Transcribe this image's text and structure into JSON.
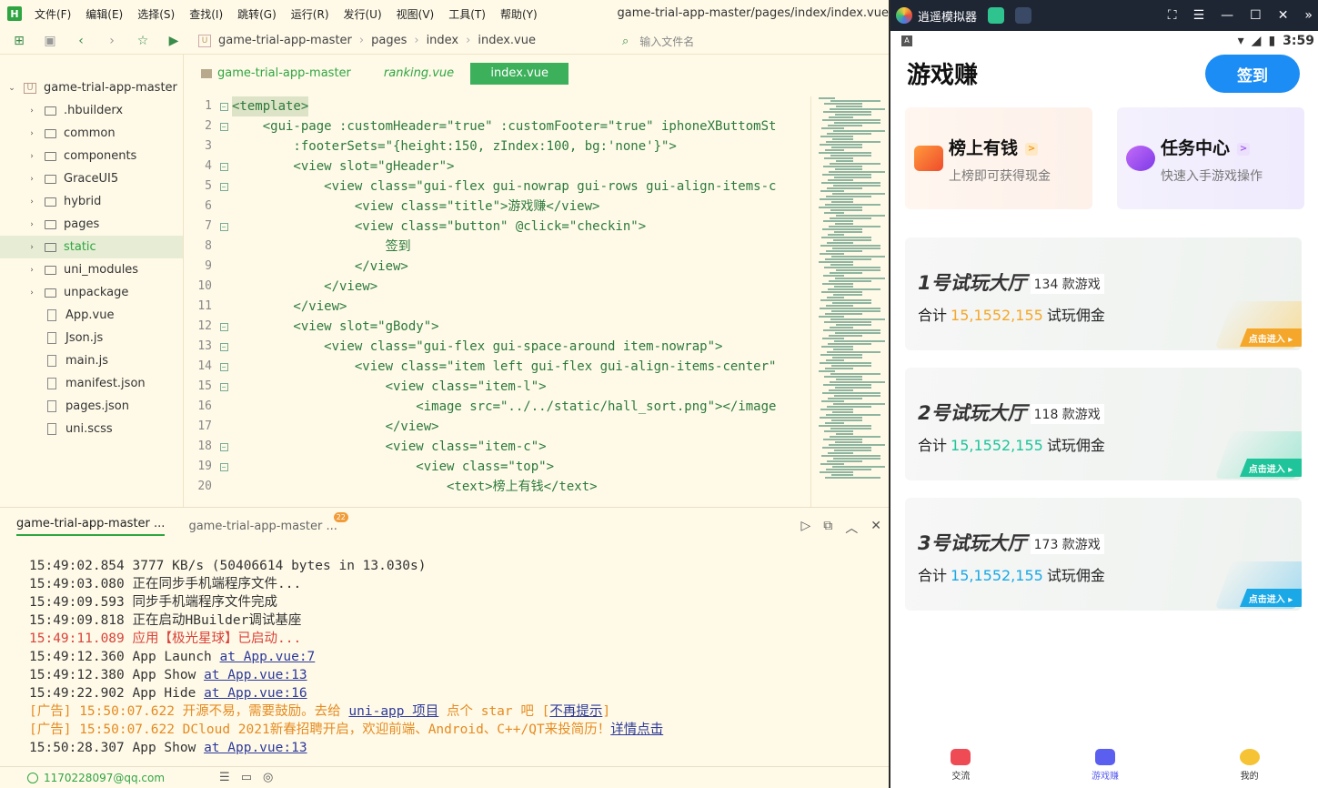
{
  "ide": {
    "logo": "H",
    "menu": [
      "文件(F)",
      "编辑(E)",
      "选择(S)",
      "查找(I)",
      "跳转(G)",
      "运行(R)",
      "发行(U)",
      "视图(V)",
      "工具(T)",
      "帮助(Y)"
    ],
    "window_title": "game-trial-app-master/pages/index/index.vue",
    "breadcrumb": [
      "game-trial-app-master",
      "pages",
      "index",
      "index.vue"
    ],
    "search_placeholder": "输入文件名",
    "tree": [
      {
        "label": "game-trial-app-master",
        "type": "project",
        "expanded": true
      },
      {
        "label": ".hbuilderx",
        "type": "folder"
      },
      {
        "label": "common",
        "type": "folder"
      },
      {
        "label": "components",
        "type": "folder"
      },
      {
        "label": "GraceUI5",
        "type": "folder"
      },
      {
        "label": "hybrid",
        "type": "folder"
      },
      {
        "label": "pages",
        "type": "folder"
      },
      {
        "label": "static",
        "type": "folder",
        "selected": true
      },
      {
        "label": "uni_modules",
        "type": "folder"
      },
      {
        "label": "unpackage",
        "type": "folder"
      },
      {
        "label": "App.vue",
        "type": "file"
      },
      {
        "label": "Json.js",
        "type": "file"
      },
      {
        "label": "main.js",
        "type": "file"
      },
      {
        "label": "manifest.json",
        "type": "file"
      },
      {
        "label": "pages.json",
        "type": "file"
      },
      {
        "label": "uni.scss",
        "type": "file"
      }
    ],
    "editor_tabs": [
      "game-trial-app-master",
      "ranking.vue",
      "index.vue"
    ],
    "code_lines": [
      "<template>",
      "    <gui-page :customHeader=\"true\" :customFooter=\"true\" iphoneXButtomSt",
      "        :footerSets=\"{height:150, zIndex:100, bg:'none'}\">",
      "        <view slot=\"gHeader\">",
      "            <view class=\"gui-flex gui-nowrap gui-rows gui-align-items-c",
      "                <view class=\"title\">游戏赚</view>",
      "                <view class=\"button\" @click=\"checkin\">",
      "                    签到",
      "                </view>",
      "            </view>",
      "        </view>",
      "        <view slot=\"gBody\">",
      "            <view class=\"gui-flex gui-space-around item-nowrap\">",
      "                <view class=\"item left gui-flex gui-align-items-center\"",
      "                    <view class=\"item-l\">",
      "                        <image src=\"../../static/hall_sort.png\"></image",
      "                    </view>",
      "                    <view class=\"item-c\">",
      "                        <view class=\"top\">",
      "                            <text>榜上有钱</text>"
    ],
    "console_tabs": [
      "game-trial-app-master ...",
      "game-trial-app-master ..."
    ],
    "console_badge": "22",
    "console_lines": [
      {
        "t": "15:49:02.854 3777 KB/s (50406614 bytes in 13.030s)",
        "c": ""
      },
      {
        "t": "15:49:03.080 正在同步手机端程序文件...",
        "c": ""
      },
      {
        "t": "15:49:09.593 同步手机端程序文件完成",
        "c": ""
      },
      {
        "t": "15:49:09.818 正在启动HBuilder调试基座",
        "c": ""
      },
      {
        "t": "15:49:11.089 应用【极光星球】已启动...",
        "c": "red"
      },
      {
        "t": "15:49:12.360 App Launch ",
        "l": "at App.vue:7",
        "c": ""
      },
      {
        "t": "15:49:12.380 App Show ",
        "l": "at App.vue:13",
        "c": ""
      },
      {
        "t": "15:49:22.902 App Hide ",
        "l": "at App.vue:16",
        "c": ""
      },
      {
        "t": "[广告] 15:50:07.622 开源不易，需要鼓励。去给 ",
        "l": "uni-app 项目",
        "t2": " 点个 star 吧 [",
        "l2": "不再提示",
        "t3": "]",
        "c": "orange"
      },
      {
        "t": "[广告] 15:50:07.622 DCloud 2021新春招聘开启，欢迎前端、Android、C++/QT来投简历！",
        "l": "详情点击",
        "c": "orange"
      },
      {
        "t": "15:50:28.307 App Show ",
        "l": "at App.vue:13",
        "c": ""
      }
    ],
    "status_user": "1170228097@qq.com"
  },
  "emulator": {
    "title": "逍遥模拟器",
    "time": "3:59",
    "app_title": "游戏赚",
    "checkin": "签到",
    "cards": [
      {
        "title": "榜上有钱",
        "sub": "上榜即可获得现金",
        "chev": ">"
      },
      {
        "title": "任务中心",
        "sub": "快速入手游戏操作",
        "chev": ">"
      }
    ],
    "halls": [
      {
        "name": "1号试玩大厅",
        "count": "134 款游戏",
        "prefix": "合计",
        "amount": "15,1552,155",
        "suffix": "试玩佣金",
        "enter": "点击进入 ▸",
        "color": "#f4a72a"
      },
      {
        "name": "2号试玩大厅",
        "count": "118 款游戏",
        "prefix": "合计",
        "amount": "15,1552,155",
        "suffix": "试玩佣金",
        "enter": "点击进入 ▸",
        "color": "#1fc49a"
      },
      {
        "name": "3号试玩大厅",
        "count": "173 款游戏",
        "prefix": "合计",
        "amount": "15,1552,155",
        "suffix": "试玩佣金",
        "enter": "点击进入 ▸",
        "color": "#1aa8e6"
      }
    ],
    "tabbar": [
      {
        "label": "交流",
        "active": false
      },
      {
        "label": "游戏赚",
        "active": true
      },
      {
        "label": "我的",
        "active": false
      }
    ]
  }
}
